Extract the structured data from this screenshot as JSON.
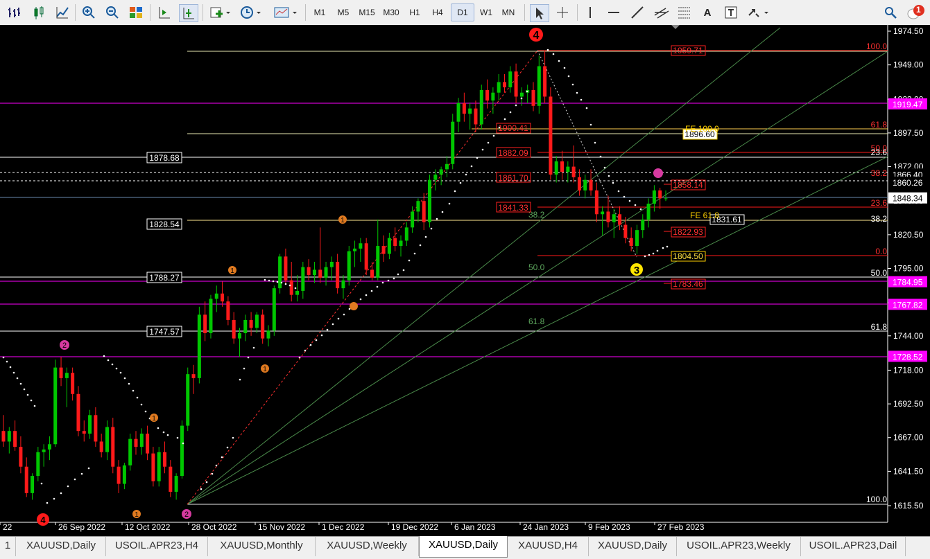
{
  "toolbar": {
    "timeframes": [
      "M1",
      "M5",
      "M15",
      "M30",
      "H1",
      "H4",
      "D1",
      "W1",
      "MN"
    ],
    "active_timeframe": "D1",
    "notification_count": "1"
  },
  "tabs": [
    "1",
    "XAUUSD,Daily",
    "USOIL.APR23,H4",
    "XAUUSD,Monthly",
    "XAUUSD,Weekly",
    "XAUUSD,Daily",
    "XAUUSD,H4",
    "XAUUSD,Daily",
    "USOIL.APR23,Weekly",
    "USOIL.APR23,Dail"
  ],
  "active_tab": 5,
  "price_axis": {
    "ticks": [
      "1974.50",
      "1949.00",
      "1923.00",
      "1897.50",
      "1872.00",
      "1846.00",
      "1820.50",
      "1795.00",
      "1769.00",
      "1744.00",
      "1718.00",
      "1692.50",
      "1667.00",
      "1641.50",
      "1615.50"
    ],
    "current_price": "1848.34",
    "markers": [
      {
        "label": "1919.47",
        "color": "#ff00ff"
      },
      {
        "label": "1866.40",
        "color": "#ffffff"
      },
      {
        "label": "1860.26",
        "color": "#ffffff"
      },
      {
        "label": "1784.95",
        "color": "#ff00ff"
      },
      {
        "label": "1767.82",
        "color": "#ff00ff"
      },
      {
        "label": "1728.52",
        "color": "#ff00ff"
      }
    ]
  },
  "time_axis": [
    "22",
    "26 Sep 2022",
    "12 Oct 2022",
    "28 Oct 2022",
    "15 Nov 2022",
    "1 Dec 2022",
    "19 Dec 2022",
    "6 Jan 2023",
    "24 Jan 2023",
    "9 Feb 2023",
    "27 Feb 2023"
  ],
  "left_levels": [
    "1878.68",
    "1828.54",
    "1788.27",
    "1747.57"
  ],
  "fib_left_labels": [
    "38.2",
    "50.0",
    "61.8"
  ],
  "fib_right_labels": [
    "100.0",
    "61.8",
    "50.0",
    "38.2",
    "23.6",
    "0.0"
  ],
  "fib_right_white": [
    "23.6",
    "38.2",
    "50.0",
    "61.8",
    "100.0"
  ],
  "red_boxes": [
    "1959.71",
    "1900.41",
    "1882.09",
    "1861.70",
    "1841.33",
    "1858.14",
    "1822.93",
    "1783.46"
  ],
  "yellow_boxes": [
    "1896.60",
    "1831.61",
    "1804.50"
  ],
  "fe_labels": [
    "FE 100.0",
    "FE 61.8"
  ],
  "wave_labels": {
    "w4_top": "4",
    "w3": "3",
    "w2": "2",
    "w1a": "1",
    "w1b": "1",
    "w1c": "1",
    "w1d": "1",
    "w1e": "1",
    "w2a": "2",
    "w2b": "2",
    "w4_bottom": "4"
  },
  "colors": {
    "bull": "#00c800",
    "bear": "#ff1a1a",
    "magenta": "#ff00ff",
    "fib_green": "#5ea85e"
  },
  "candles": [
    {
      "o": 1672,
      "h": 1684,
      "l": 1660,
      "c": 1664
    },
    {
      "o": 1664,
      "h": 1675,
      "l": 1655,
      "c": 1672
    },
    {
      "o": 1672,
      "h": 1680,
      "l": 1657,
      "c": 1660
    },
    {
      "o": 1660,
      "h": 1668,
      "l": 1640,
      "c": 1645
    },
    {
      "o": 1645,
      "h": 1652,
      "l": 1622,
      "c": 1625
    },
    {
      "o": 1625,
      "h": 1640,
      "l": 1620,
      "c": 1638
    },
    {
      "o": 1638,
      "h": 1660,
      "l": 1634,
      "c": 1656
    },
    {
      "o": 1656,
      "h": 1662,
      "l": 1645,
      "c": 1658
    },
    {
      "o": 1658,
      "h": 1668,
      "l": 1650,
      "c": 1662
    },
    {
      "o": 1662,
      "h": 1726,
      "l": 1660,
      "c": 1720
    },
    {
      "o": 1720,
      "h": 1728,
      "l": 1706,
      "c": 1712
    },
    {
      "o": 1712,
      "h": 1720,
      "l": 1690,
      "c": 1716
    },
    {
      "o": 1716,
      "h": 1720,
      "l": 1695,
      "c": 1700
    },
    {
      "o": 1700,
      "h": 1706,
      "l": 1668,
      "c": 1672
    },
    {
      "o": 1672,
      "h": 1680,
      "l": 1664,
      "c": 1670
    },
    {
      "o": 1670,
      "h": 1688,
      "l": 1666,
      "c": 1684
    },
    {
      "o": 1684,
      "h": 1690,
      "l": 1660,
      "c": 1664
    },
    {
      "o": 1664,
      "h": 1670,
      "l": 1652,
      "c": 1656
    },
    {
      "o": 1656,
      "h": 1680,
      "l": 1650,
      "c": 1675
    },
    {
      "o": 1675,
      "h": 1682,
      "l": 1640,
      "c": 1645
    },
    {
      "o": 1645,
      "h": 1650,
      "l": 1625,
      "c": 1632
    },
    {
      "o": 1632,
      "h": 1648,
      "l": 1628,
      "c": 1646
    },
    {
      "o": 1646,
      "h": 1670,
      "l": 1642,
      "c": 1666
    },
    {
      "o": 1666,
      "h": 1672,
      "l": 1654,
      "c": 1660
    },
    {
      "o": 1660,
      "h": 1674,
      "l": 1654,
      "c": 1670
    },
    {
      "o": 1670,
      "h": 1676,
      "l": 1650,
      "c": 1655
    },
    {
      "o": 1655,
      "h": 1660,
      "l": 1630,
      "c": 1634
    },
    {
      "o": 1634,
      "h": 1660,
      "l": 1630,
      "c": 1656
    },
    {
      "o": 1656,
      "h": 1664,
      "l": 1640,
      "c": 1645
    },
    {
      "o": 1645,
      "h": 1650,
      "l": 1622,
      "c": 1626
    },
    {
      "o": 1626,
      "h": 1640,
      "l": 1620,
      "c": 1638
    },
    {
      "o": 1638,
      "h": 1680,
      "l": 1636,
      "c": 1676
    },
    {
      "o": 1676,
      "h": 1720,
      "l": 1672,
      "c": 1715
    },
    {
      "o": 1715,
      "h": 1722,
      "l": 1700,
      "c": 1712
    },
    {
      "o": 1712,
      "h": 1766,
      "l": 1708,
      "c": 1760
    },
    {
      "o": 1760,
      "h": 1770,
      "l": 1740,
      "c": 1746
    },
    {
      "o": 1746,
      "h": 1775,
      "l": 1742,
      "c": 1772
    },
    {
      "o": 1772,
      "h": 1782,
      "l": 1762,
      "c": 1776
    },
    {
      "o": 1776,
      "h": 1785,
      "l": 1766,
      "c": 1770
    },
    {
      "o": 1770,
      "h": 1774,
      "l": 1752,
      "c": 1756
    },
    {
      "o": 1756,
      "h": 1762,
      "l": 1738,
      "c": 1742
    },
    {
      "o": 1742,
      "h": 1750,
      "l": 1728,
      "c": 1746
    },
    {
      "o": 1746,
      "h": 1760,
      "l": 1740,
      "c": 1756
    },
    {
      "o": 1756,
      "h": 1762,
      "l": 1744,
      "c": 1750
    },
    {
      "o": 1750,
      "h": 1762,
      "l": 1746,
      "c": 1760
    },
    {
      "o": 1760,
      "h": 1764,
      "l": 1738,
      "c": 1742
    },
    {
      "o": 1742,
      "h": 1752,
      "l": 1736,
      "c": 1748
    },
    {
      "o": 1748,
      "h": 1782,
      "l": 1744,
      "c": 1780
    },
    {
      "o": 1780,
      "h": 1806,
      "l": 1776,
      "c": 1804
    },
    {
      "o": 1804,
      "h": 1810,
      "l": 1784,
      "c": 1786
    },
    {
      "o": 1786,
      "h": 1800,
      "l": 1770,
      "c": 1775
    },
    {
      "o": 1775,
      "h": 1790,
      "l": 1770,
      "c": 1778
    },
    {
      "o": 1778,
      "h": 1800,
      "l": 1772,
      "c": 1796
    },
    {
      "o": 1796,
      "h": 1802,
      "l": 1786,
      "c": 1790
    },
    {
      "o": 1790,
      "h": 1800,
      "l": 1784,
      "c": 1794
    },
    {
      "o": 1794,
      "h": 1826,
      "l": 1784,
      "c": 1788
    },
    {
      "o": 1788,
      "h": 1800,
      "l": 1782,
      "c": 1796
    },
    {
      "o": 1796,
      "h": 1804,
      "l": 1786,
      "c": 1800
    },
    {
      "o": 1800,
      "h": 1806,
      "l": 1776,
      "c": 1780
    },
    {
      "o": 1780,
      "h": 1790,
      "l": 1772,
      "c": 1786
    },
    {
      "o": 1786,
      "h": 1812,
      "l": 1782,
      "c": 1808
    },
    {
      "o": 1808,
      "h": 1816,
      "l": 1796,
      "c": 1810
    },
    {
      "o": 1810,
      "h": 1818,
      "l": 1800,
      "c": 1814
    },
    {
      "o": 1814,
      "h": 1818,
      "l": 1790,
      "c": 1794
    },
    {
      "o": 1794,
      "h": 1800,
      "l": 1786,
      "c": 1788
    },
    {
      "o": 1788,
      "h": 1832,
      "l": 1786,
      "c": 1812
    },
    {
      "o": 1812,
      "h": 1820,
      "l": 1800,
      "c": 1806
    },
    {
      "o": 1806,
      "h": 1822,
      "l": 1802,
      "c": 1818
    },
    {
      "o": 1818,
      "h": 1826,
      "l": 1808,
      "c": 1812
    },
    {
      "o": 1812,
      "h": 1820,
      "l": 1804,
      "c": 1816
    },
    {
      "o": 1816,
      "h": 1830,
      "l": 1812,
      "c": 1826
    },
    {
      "o": 1826,
      "h": 1842,
      "l": 1822,
      "c": 1838
    },
    {
      "o": 1838,
      "h": 1848,
      "l": 1830,
      "c": 1846
    },
    {
      "o": 1846,
      "h": 1852,
      "l": 1824,
      "c": 1830
    },
    {
      "o": 1830,
      "h": 1866,
      "l": 1826,
      "c": 1862
    },
    {
      "o": 1862,
      "h": 1870,
      "l": 1854,
      "c": 1866
    },
    {
      "o": 1866,
      "h": 1872,
      "l": 1858,
      "c": 1870
    },
    {
      "o": 1870,
      "h": 1880,
      "l": 1864,
      "c": 1874
    },
    {
      "o": 1874,
      "h": 1912,
      "l": 1870,
      "c": 1906
    },
    {
      "o": 1906,
      "h": 1924,
      "l": 1898,
      "c": 1920
    },
    {
      "o": 1920,
      "h": 1928,
      "l": 1906,
      "c": 1912
    },
    {
      "o": 1912,
      "h": 1920,
      "l": 1900,
      "c": 1916
    },
    {
      "o": 1916,
      "h": 1922,
      "l": 1898,
      "c": 1904
    },
    {
      "o": 1904,
      "h": 1934,
      "l": 1900,
      "c": 1930
    },
    {
      "o": 1930,
      "h": 1938,
      "l": 1916,
      "c": 1922
    },
    {
      "o": 1922,
      "h": 1932,
      "l": 1912,
      "c": 1928
    },
    {
      "o": 1928,
      "h": 1942,
      "l": 1922,
      "c": 1936
    },
    {
      "o": 1936,
      "h": 1942,
      "l": 1928,
      "c": 1932
    },
    {
      "o": 1932,
      "h": 1948,
      "l": 1928,
      "c": 1944
    },
    {
      "o": 1944,
      "h": 1950,
      "l": 1920,
      "c": 1925
    },
    {
      "o": 1925,
      "h": 1932,
      "l": 1918,
      "c": 1928
    },
    {
      "o": 1928,
      "h": 1934,
      "l": 1920,
      "c": 1930
    },
    {
      "o": 1930,
      "h": 1936,
      "l": 1914,
      "c": 1918
    },
    {
      "o": 1918,
      "h": 1956,
      "l": 1912,
      "c": 1948
    },
    {
      "o": 1948,
      "h": 1960,
      "l": 1920,
      "c": 1925
    },
    {
      "o": 1925,
      "h": 1932,
      "l": 1862,
      "c": 1866
    },
    {
      "o": 1866,
      "h": 1880,
      "l": 1860,
      "c": 1876
    },
    {
      "o": 1876,
      "h": 1884,
      "l": 1862,
      "c": 1868
    },
    {
      "o": 1868,
      "h": 1876,
      "l": 1860,
      "c": 1872
    },
    {
      "o": 1872,
      "h": 1888,
      "l": 1860,
      "c": 1864
    },
    {
      "o": 1864,
      "h": 1870,
      "l": 1850,
      "c": 1854
    },
    {
      "o": 1854,
      "h": 1866,
      "l": 1848,
      "c": 1862
    },
    {
      "o": 1862,
      "h": 1870,
      "l": 1850,
      "c": 1854
    },
    {
      "o": 1854,
      "h": 1860,
      "l": 1830,
      "c": 1836
    },
    {
      "o": 1836,
      "h": 1842,
      "l": 1820,
      "c": 1838
    },
    {
      "o": 1838,
      "h": 1850,
      "l": 1826,
      "c": 1830
    },
    {
      "o": 1830,
      "h": 1840,
      "l": 1818,
      "c": 1836
    },
    {
      "o": 1836,
      "h": 1842,
      "l": 1824,
      "c": 1828
    },
    {
      "o": 1828,
      "h": 1834,
      "l": 1814,
      "c": 1818
    },
    {
      "o": 1818,
      "h": 1826,
      "l": 1808,
      "c": 1812
    },
    {
      "o": 1812,
      "h": 1828,
      "l": 1806,
      "c": 1824
    },
    {
      "o": 1824,
      "h": 1836,
      "l": 1818,
      "c": 1832
    },
    {
      "o": 1832,
      "h": 1848,
      "l": 1826,
      "c": 1844
    },
    {
      "o": 1844,
      "h": 1858,
      "l": 1838,
      "c": 1854
    },
    {
      "o": 1854,
      "h": 1856,
      "l": 1840,
      "c": 1848
    },
    {
      "o": 1848,
      "h": 1854,
      "l": 1846,
      "c": 1848
    }
  ]
}
